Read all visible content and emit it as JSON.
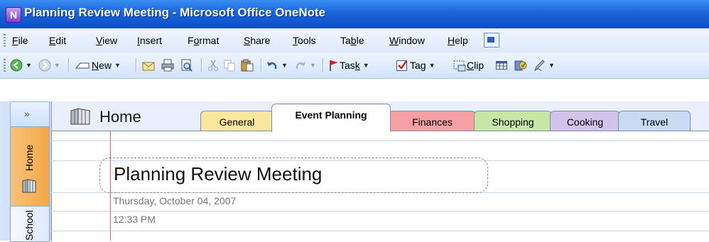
{
  "window": {
    "title": "Planning Review Meeting - Microsoft Office OneNote"
  },
  "menu": [
    {
      "pre": "",
      "key": "F",
      "post": "ile"
    },
    {
      "pre": "",
      "key": "E",
      "post": "dit"
    },
    {
      "pre": "",
      "key": "V",
      "post": "iew"
    },
    {
      "pre": "",
      "key": "I",
      "post": "nsert"
    },
    {
      "pre": "F",
      "key": "o",
      "post": "rmat"
    },
    {
      "pre": "",
      "key": "S",
      "post": "hare"
    },
    {
      "pre": "",
      "key": "T",
      "post": "ools"
    },
    {
      "pre": "Ta",
      "key": "b",
      "post": "le"
    },
    {
      "pre": "",
      "key": "W",
      "post": "indow"
    },
    {
      "pre": "",
      "key": "H",
      "post": "elp"
    }
  ],
  "toolbar": {
    "new": {
      "key": "N",
      "post": "ew"
    },
    "task": {
      "pre": "Tas",
      "key": "k"
    },
    "tag": {
      "pre": "Ta",
      "key": "g"
    },
    "clip": {
      "key": "C",
      "post": "lip"
    }
  },
  "icons": [
    "back-icon",
    "forward-icon",
    "new-page-icon",
    "email-icon",
    "print-icon",
    "print-preview-icon",
    "cut-icon",
    "copy-icon",
    "paste-icon",
    "undo-icon",
    "redo-icon",
    "task-flag-icon",
    "tag-checkbox-icon",
    "screen-clip-icon",
    "table-icon",
    "research-icon",
    "pen-icon"
  ],
  "navigation": {
    "collapse": "»",
    "notebooks": [
      "Home",
      "School"
    ]
  },
  "section_name": "Home",
  "tabs": [
    {
      "label": "General",
      "color": "#f9e79d"
    },
    {
      "label": "Event Planning",
      "color": "#ffffff",
      "active": true
    },
    {
      "label": "Finances",
      "color": "#f5a0a2"
    },
    {
      "label": "Shopping",
      "color": "#c7e7a7"
    },
    {
      "label": "Cooking",
      "color": "#d2c3ea"
    },
    {
      "label": "Travel",
      "color": "#c7dcf3"
    }
  ],
  "page": {
    "title": "Planning Review Meeting",
    "date": "Thursday, October 04, 2007",
    "time": "12:33 PM"
  }
}
